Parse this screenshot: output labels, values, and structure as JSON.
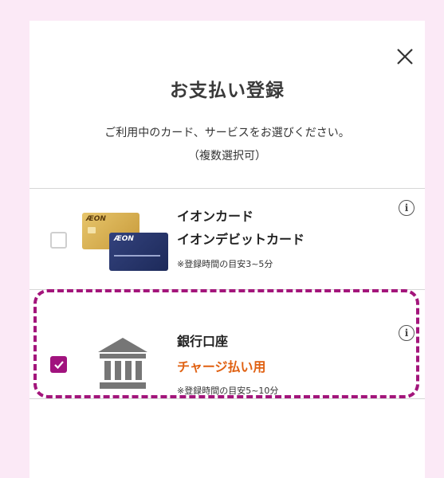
{
  "dialog": {
    "title": "お支払い登録",
    "description_line1": "ご利用中のカード、サービスをお選びください。",
    "description_line2": "（複数選択可）"
  },
  "options": [
    {
      "name_line1": "イオンカード",
      "name_line2": "イオンデビットカード",
      "note": "※登録時間の目安3~5分",
      "checked": false,
      "icon": "aeon-card-image"
    },
    {
      "name_line1": "銀行口座",
      "name_line2": "チャージ払い用",
      "note": "※登録時間の目安5~10分",
      "checked": true,
      "icon": "bank-icon"
    }
  ],
  "card_brand": "ÆON",
  "colors": {
    "background": "#fbe9f6",
    "accent": "#a1137e",
    "charge_text": "#e06112",
    "highlight_border": "#a3157b"
  }
}
